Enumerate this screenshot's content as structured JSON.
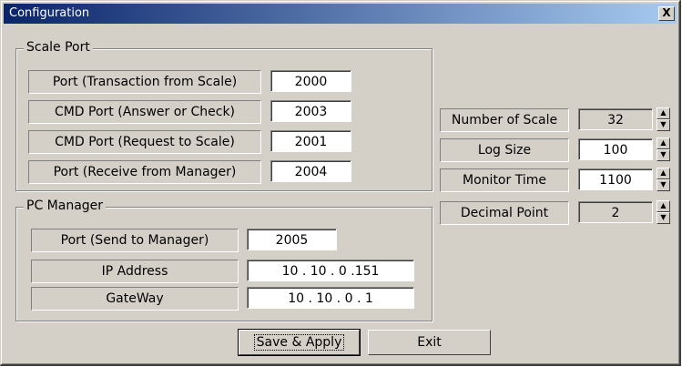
{
  "window": {
    "title": "Configuration",
    "close_label": "X"
  },
  "scale_port": {
    "title": "Scale Port",
    "rows": [
      {
        "label": "Port (Transaction from Scale)",
        "value": "2000"
      },
      {
        "label": "CMD Port (Answer or Check)",
        "value": "2003"
      },
      {
        "label": "CMD Port (Request to Scale)",
        "value": "2001"
      },
      {
        "label": "Port (Receive from Manager)",
        "value": "2004"
      }
    ]
  },
  "pc_manager": {
    "title": "PC Manager",
    "port_label": "Port (Send to Manager)",
    "port_value": "2005",
    "ip_label": "IP Address",
    "ip_value": "10 . 10 . 0 .151",
    "gateway_label": "GateWay",
    "gateway_value": "10 . 10 . 0 . 1"
  },
  "settings": [
    {
      "label": "Number of Scale",
      "value": "32"
    },
    {
      "label": "Log Size",
      "value": "100"
    },
    {
      "label": "Monitor Time",
      "value": "1100"
    },
    {
      "label": "Decimal Point",
      "value": "2"
    }
  ],
  "buttons": {
    "save": "Save & Apply",
    "exit": "Exit"
  },
  "colors": {
    "titlebar_start": "#0a246a",
    "titlebar_end": "#a6caf0",
    "face": "#d4d0c8"
  },
  "icons": {
    "spin_up": "▲",
    "spin_down": "▼"
  }
}
